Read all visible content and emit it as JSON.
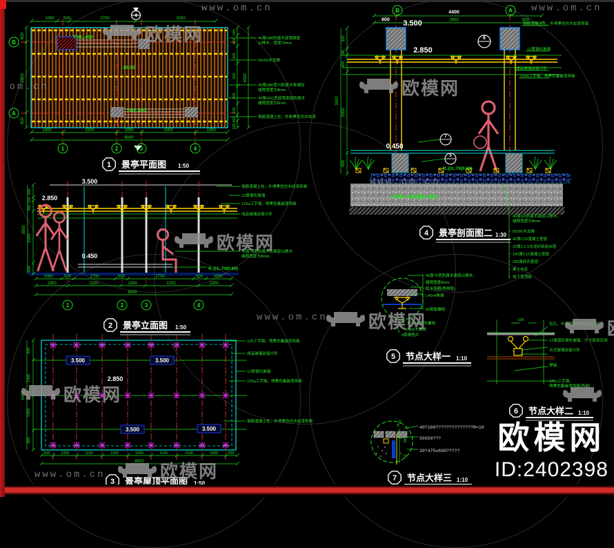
{
  "watermark": {
    "brand": "欧模网",
    "site": "www.om.cn",
    "id": "ID:2402398"
  },
  "plan": {
    "no": "1",
    "title": "景亭平面图",
    "scale": "1:50",
    "sec_mark": "4",
    "top": [
      "1050",
      "500",
      "2700",
      "3250"
    ],
    "bottom": [
      "1300",
      "2200",
      "1000",
      "2200",
      "1300"
    ],
    "bottom_total": "8000",
    "left": [
      "600",
      "2800",
      "600"
    ],
    "right": [
      "100",
      "400",
      "500",
      "900",
      "900",
      "500",
      "400",
      "100"
    ],
    "right_total": "4000",
    "cols": [
      "1",
      "2",
      "3",
      "4"
    ],
    "rows": [
      "B",
      "A"
    ],
    "lv_bench": "TWL.450",
    "lv_zero": "±0.00",
    "notes": [
      "40厚H80防腐木座凳面层",
      "山樟木，宽度70mm",
      "50x50木龙骨",
      "40厚H80宽70防腐木条铺设",
      "缝隙宽度为8mm",
      "40厚H(X)宽座凳面层防腐木",
      "缝隙宽度为8mm",
      "钢筋混凝土柱，外刷黑色仿木纹漆"
    ]
  },
  "elev": {
    "no": "2",
    "title": "景亭立面图",
    "scale": "1:50",
    "lv": [
      "3.500",
      "2.850",
      "0.450"
    ],
    "leftd": [
      "500",
      "150",
      "400",
      "2000",
      "450"
    ],
    "left_total": "3500",
    "r1": [
      "1050",
      "500",
      "1700",
      "500",
      "2700",
      "500",
      "1050"
    ],
    "r2": [
      "1300",
      "2200",
      "1000",
      "2200",
      "1300"
    ],
    "r3": "8000",
    "cols": [
      "1",
      "2",
      "3",
      "4"
    ],
    "notes": [
      "钢筋混凝土柱，外喷黑色仿木纹漆饰面",
      "12厚钢化玻璃",
      "125a工字钢，喷黑色氟碳漆饰面",
      "成品玻璃驳接爪件",
      "40厚70宽防腐木条面层山樟木",
      "缝隙宽度为8mm"
    ],
    "lv_note": "R.@L.70(0.60)"
  },
  "roof": {
    "no": "3",
    "title": "景亭屋顶平面图",
    "scale": "1:50",
    "lv35": "3.500",
    "lv285": "2.850",
    "leftd": [
      "800",
      "1400",
      "1400",
      "800"
    ],
    "left_total": "4400",
    "bottom": [
      "500",
      "1000",
      "1100",
      "1100",
      "1000",
      "1100",
      "1100",
      "1000",
      "500"
    ],
    "bottom_total": "8000",
    "notes": [
      "125工字钢，喷黑色氟碳漆饰面",
      "成品玻璃驳接爪件",
      "12厚钢化玻璃",
      "125a工字钢，喷黑色氟碳漆饰面",
      "钢筋混凝土柱，外喷黑色仿木纹漆饰面"
    ]
  },
  "sect": {
    "no": "4",
    "title": "景亭剖面图二",
    "scale": "1:30",
    "det6": "6",
    "det7": "7",
    "det5": "5",
    "grid": [
      "B",
      "A"
    ],
    "top_total": "4400",
    "top": [
      "600",
      "2900",
      "800"
    ],
    "lv": [
      "3.500",
      "2.850",
      "0.450"
    ],
    "leftd": [
      "500",
      "150",
      "400",
      "2000",
      "450"
    ],
    "left_total": "3500",
    "lv_note": "R.@L.70(0.60)",
    "base": "400厚C15素混凝土垫层",
    "notes_top": [
      "钢筋混凝土柱，外喷黑色仿木纹漆饰面",
      "12厚钢化玻璃",
      "成品玻璃驳接爪件",
      "125a工字钢，喷黑色氟碳漆饰面"
    ],
    "notes": [
      "40厚(H)防腐木面层山樟木，",
      "缝隙宽度为8mm",
      "50x50木龙骨",
      "40厚C15混凝土垫层",
      "20厚1:2.5水泥砂浆结合层",
      "100厚C15混凝土垫层",
      "200厚碎石垫层",
      "素土夯实",
      "地下室顶板"
    ]
  },
  "n1": {
    "no": "5",
    "title": "节点大样一",
    "scale": "1:10",
    "notes": [
      "40厚70宽防腐木面层山樟木，",
      "缝隙宽度8mm",
      "防水垫圈(两侧垫)",
      "L40x4角钢",
      "8#膨胀螺栓",
      "直径M8圆头螺栓",
      "40x50木龙骨",
      "4厚钢垫片"
    ]
  },
  "n2": {
    "no": "6",
    "title": "节点大样二",
    "scale": "1:10",
    "dim": "100",
    "notes": [
      "钻孔，中心预留安装驳接爪栓",
      "12厚弧形钢化玻璃，尺寸现场实测",
      "点式玻璃驳接爪件",
      "焊接",
      "125a工字钢，",
      "喷黑色氟碳漆饰面(两遍)"
    ]
  },
  "n3": {
    "no": "7",
    "title": "节点大样三",
    "scale": "1:10",
    "d1": "R10",
    "d2": "240",
    "d3": "10",
    "notes": [
      "40?100??????????????R=10",
      "50X50???",
      "20?475x600?????"
    ]
  }
}
